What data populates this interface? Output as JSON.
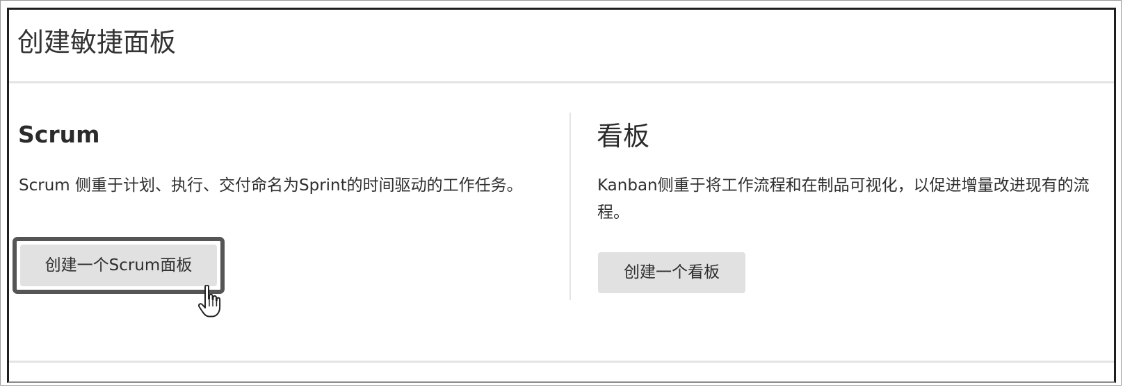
{
  "dialog": {
    "title": "创建敏捷面板"
  },
  "options": {
    "scrum": {
      "heading": "Scrum",
      "description": "Scrum 侧重于计划、执行、交付命名为Sprint的时间驱动的工作任务。",
      "button_label": "创建一个Scrum面板"
    },
    "kanban": {
      "heading": "看板",
      "description": "Kanban侧重于将工作流程和在制品可视化，以促进增量改进现有的流程。",
      "button_label": "创建一个看板"
    }
  },
  "icons": {
    "cursor": "hand-pointer-icon"
  },
  "colors": {
    "button_bg": "#e1e1e1",
    "highlight_border": "#555555",
    "divider": "#e4e4e4"
  }
}
